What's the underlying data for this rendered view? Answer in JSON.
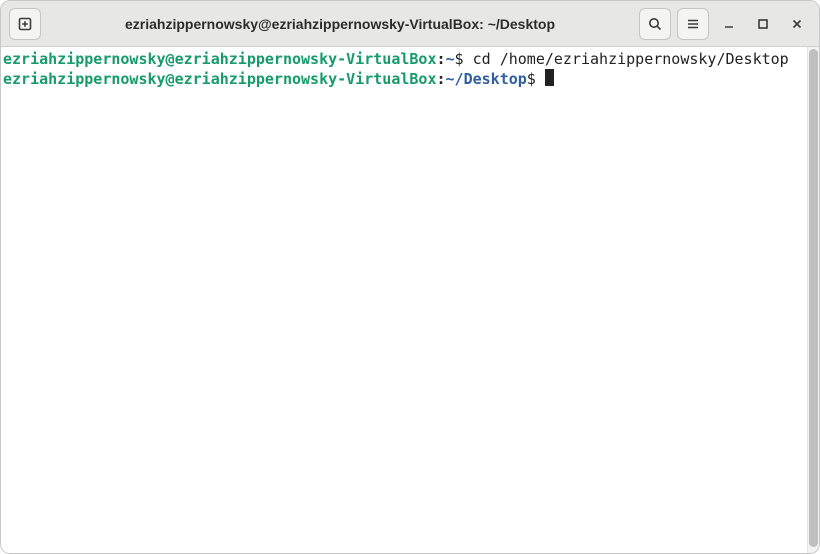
{
  "window": {
    "title": "ezriahzippernowsky@ezriahzippernowsky-VirtualBox: ~/Desktop"
  },
  "icons": {
    "new_tab": "new-tab-icon",
    "search": "search-icon",
    "menu": "hamburger-icon",
    "minimize": "minimize-icon",
    "maximize": "maximize-icon",
    "close": "close-icon"
  },
  "terminal": {
    "lines": [
      {
        "user_host": "ezriahzippernowsky@ezriahzippernowsky-VirtualBox",
        "colon": ":",
        "path": "~",
        "prompt_symbol": "$",
        "command": " cd /home/ezriahzippernowsky/Desktop"
      },
      {
        "user_host": "ezriahzippernowsky@ezriahzippernowsky-VirtualBox",
        "colon": ":",
        "path": "~/Desktop",
        "prompt_symbol": "$",
        "command": ""
      }
    ]
  }
}
